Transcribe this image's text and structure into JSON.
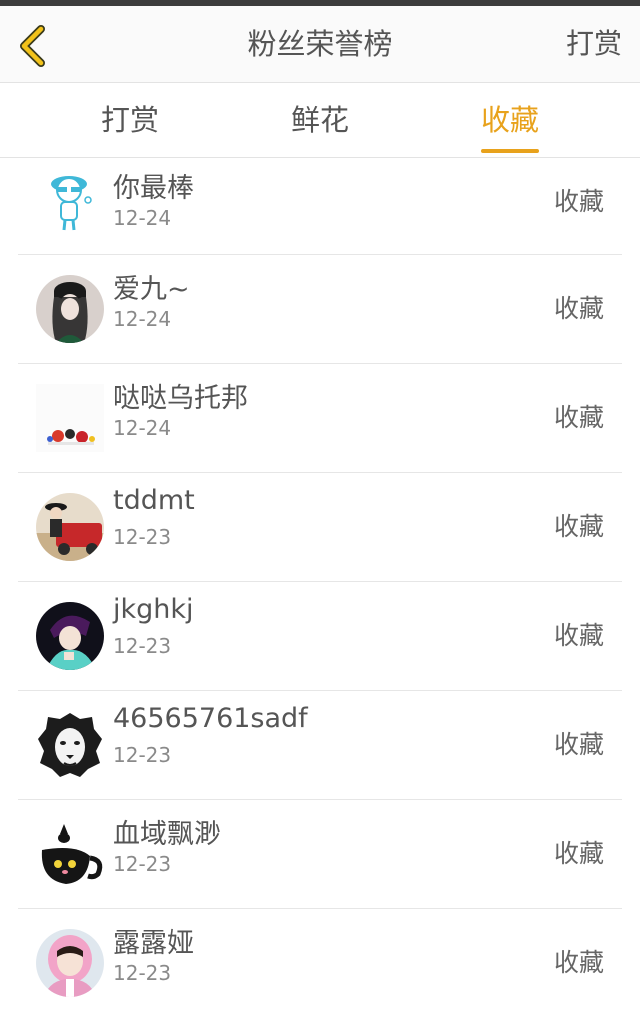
{
  "header": {
    "title": "粉丝荣誉榜",
    "action_label": "打赏"
  },
  "tabs": [
    {
      "label": "打赏",
      "active": false
    },
    {
      "label": "鲜花",
      "active": false
    },
    {
      "label": "收藏",
      "active": true
    }
  ],
  "colors": {
    "accent": "#e8a21c",
    "text": "#555555",
    "date": "#8a8a8a"
  },
  "fans": [
    {
      "name": "你最棒",
      "date": "12-24",
      "action": "收藏",
      "avatar": "cartoon-boy-avatar-icon"
    },
    {
      "name": "爱九~",
      "date": "12-24",
      "action": "收藏",
      "avatar": "girl-cap-avatar-icon"
    },
    {
      "name": "哒哒乌托邦",
      "date": "12-24",
      "action": "收藏",
      "avatar": "toys-avatar-icon"
    },
    {
      "name": "tddmt",
      "date": "12-23",
      "action": "收藏",
      "avatar": "child-car-avatar-icon"
    },
    {
      "name": "jkghkj",
      "date": "12-23",
      "action": "收藏",
      "avatar": "anime-boy-avatar-icon"
    },
    {
      "name": "46565761sadf",
      "date": "12-23",
      "action": "收藏",
      "avatar": "lion-avatar-icon"
    },
    {
      "name": "血域飘渺",
      "date": "12-23",
      "action": "收藏",
      "avatar": "black-cat-cup-avatar-icon"
    },
    {
      "name": "露露娅",
      "date": "12-23",
      "action": "收藏",
      "avatar": "girl-pink-hood-avatar-icon"
    }
  ]
}
